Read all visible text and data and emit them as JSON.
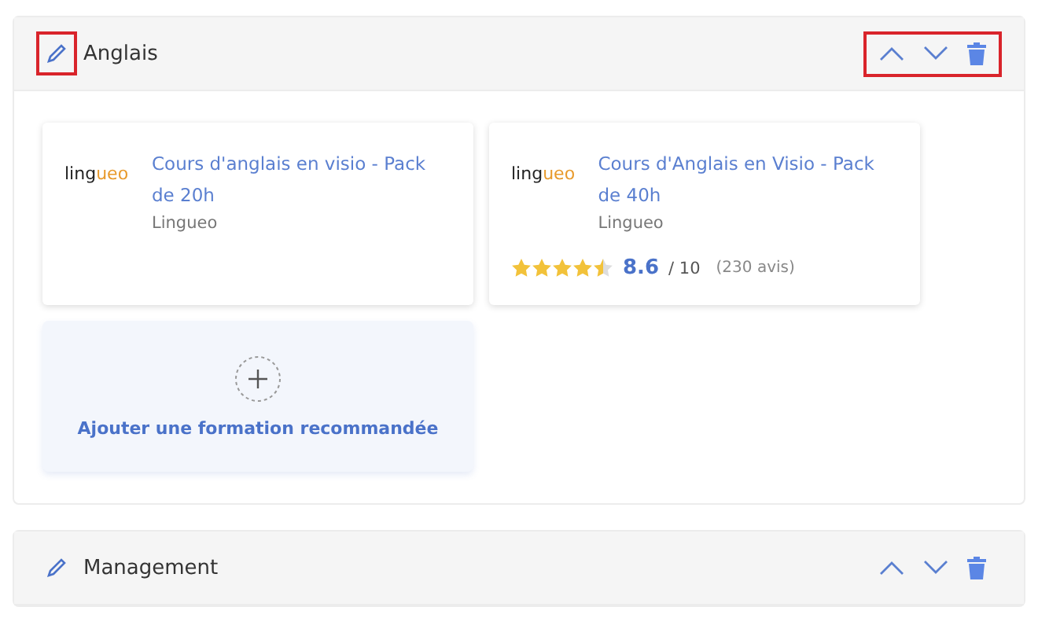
{
  "sections": [
    {
      "title": "Anglais",
      "highlighted": true,
      "expanded": true,
      "courses": [
        {
          "logo": {
            "main": "ling",
            "accent": "ueo"
          },
          "title": "Cours d'anglais en visio - Pack de 20h",
          "provider": "Lingueo"
        },
        {
          "logo": {
            "main": "ling",
            "accent": "ueo"
          },
          "title": "Cours d'Anglais en Visio - Pack de 40h",
          "provider": "Lingueo",
          "stars": 4.5,
          "score": "8.6",
          "scale": "/ 10",
          "reviews": "(230 avis)"
        }
      ],
      "add_label": "Ajouter une formation recommandée"
    },
    {
      "title": "Management",
      "highlighted": false,
      "expanded": false
    }
  ]
}
